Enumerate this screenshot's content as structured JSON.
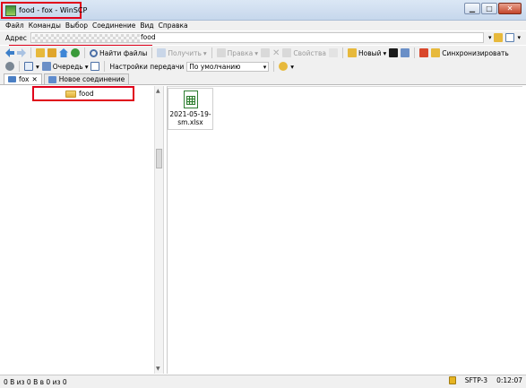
{
  "window": {
    "title": "food - fox - WinSCP",
    "min_label": "▁",
    "max_label": "□",
    "close_label": "✕"
  },
  "menu": [
    "Файл",
    "Команды",
    "Выбор",
    "Соединение",
    "Вид",
    "Справка"
  ],
  "address": {
    "label": "Адрес",
    "value": "food"
  },
  "toolbar1": {
    "find_files": "Найти файлы",
    "download": "Получить",
    "edit": "Правка",
    "properties": "Свойства",
    "new": "Новый",
    "synchronize": "Синхронизировать"
  },
  "toolbar2": {
    "queue": "Очередь",
    "transfer_settings_label": "Настройки передачи",
    "transfer_settings_value": "По умолчанию"
  },
  "tabs": {
    "session": "fox",
    "new_session": "Новое соединение"
  },
  "tree": {
    "folder": "food"
  },
  "files": [
    {
      "name": "2021-05-19-sm.xlsx"
    }
  ],
  "status": {
    "selection": "0 B из 0 B в 0 из 0",
    "protocol": "SFTP-3",
    "timer": "0:12:07"
  },
  "colors": {
    "highlight": "#e0001a",
    "excel_green": "#2e7d32"
  }
}
